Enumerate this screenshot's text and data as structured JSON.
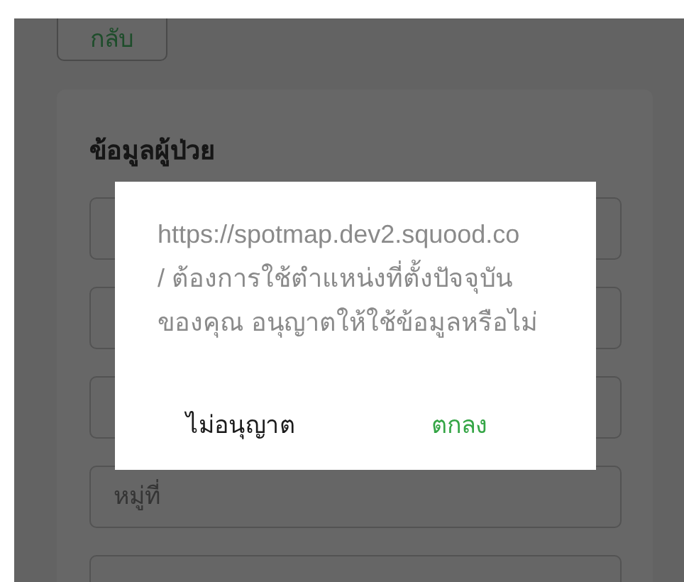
{
  "back_button": "กลับ",
  "card": {
    "heading": "ข้อมูลผู้ป่วย",
    "fields": [
      {
        "kind": "covered"
      },
      {
        "kind": "covered"
      },
      {
        "kind": "covered"
      },
      {
        "kind": "text",
        "placeholder": "หมู่ที่"
      },
      {
        "kind": "text"
      }
    ]
  },
  "dialog": {
    "message": "https://spotmap.dev2.squood.co\n/ ต้องการใช้ตำแหน่งที่ตั้งปัจจุบัน\nของคุณ อนุญาตให้ใช้ข้อมูลหรือไม่",
    "buttons": [
      {
        "label": "ไม่อนุญาต",
        "kind": "deny"
      },
      {
        "label": "ตกลง",
        "kind": "confirm"
      }
    ]
  }
}
